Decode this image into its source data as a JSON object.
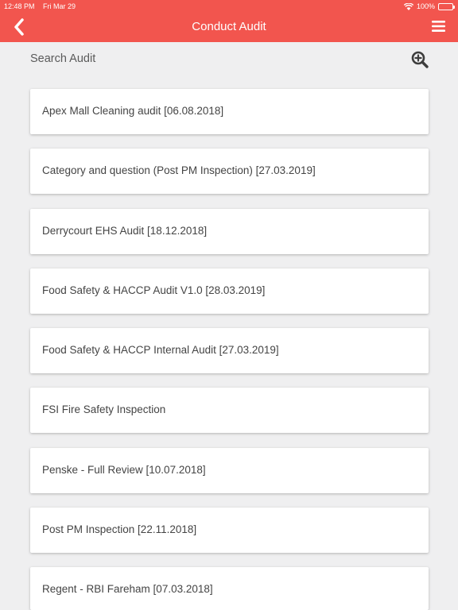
{
  "status_bar": {
    "time": "12:48 PM",
    "date": "Fri Mar 29",
    "battery": "100%"
  },
  "header": {
    "title": "Conduct Audit",
    "background": "#f2554e"
  },
  "search": {
    "label": "Search Audit"
  },
  "audits": [
    "Apex Mall Cleaning audit [06.08.2018]",
    "Category and question (Post PM Inspection) [27.03.2019]",
    "Derrycourt EHS Audit [18.12.2018]",
    "Food Safety & HACCP Audit V1.0 [28.03.2019]",
    "Food Safety & HACCP Internal Audit [27.03.2019]",
    "FSI Fire Safety Inspection",
    "Penske - Full Review [10.07.2018]",
    "Post PM Inspection [22.11.2018]",
    "Regent - RBI Fareham [07.03.2018]"
  ],
  "icons": {
    "back": "chevron-left-icon",
    "menu": "hamburger-menu-icon",
    "search": "zoom-in-icon",
    "wifi": "wifi-icon",
    "battery": "battery-icon"
  }
}
